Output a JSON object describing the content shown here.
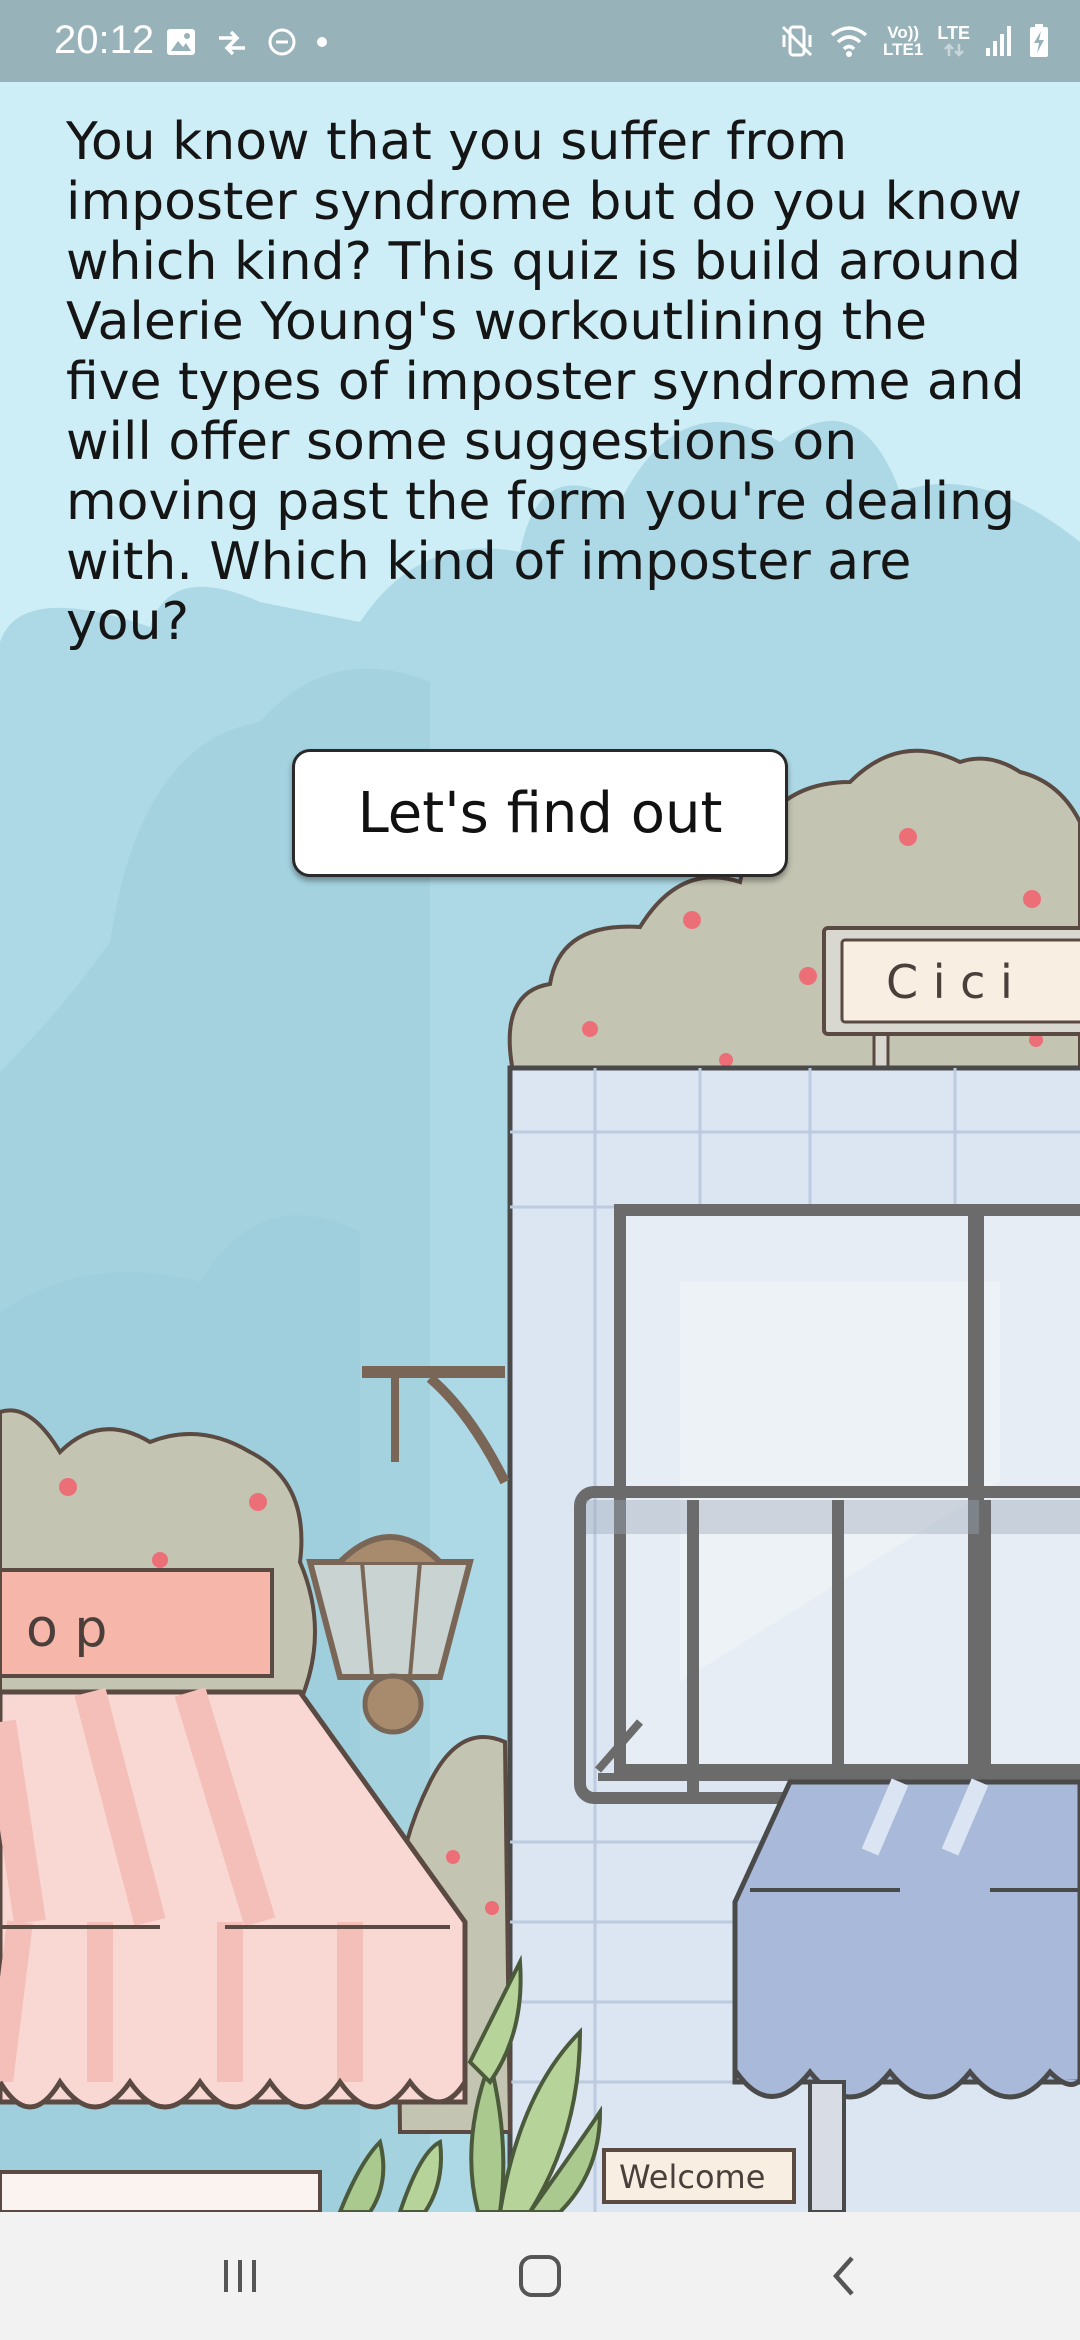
{
  "status_bar": {
    "time": "20:12",
    "left_icons": [
      "image-icon",
      "sync-icon",
      "do-not-disturb-icon",
      "dot-icon"
    ],
    "volte_label": "Vo))",
    "lte_label": "LTE",
    "lte1_label": "LTE1",
    "battery": "charging"
  },
  "quiz": {
    "intro_text": "You know that you suffer from imposter syndrome but do you know which kind? This quiz is build around Valerie Young's workoutlining the five types of imposter syndrome and will offer some suggestions on moving past the form you're dealing with. Which kind of imposter are you?",
    "start_button": "Let's find out"
  },
  "scene": {
    "shop_sign_right": "C i c i",
    "shop_sign_left": "o p",
    "welcome_sign": "Welcome"
  },
  "nav_bar": {
    "icons": [
      "recent-apps-icon",
      "home-icon",
      "back-icon"
    ]
  }
}
